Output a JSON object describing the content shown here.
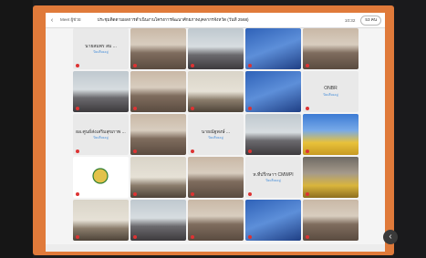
{
  "topbar": {
    "back_icon": "‹",
    "app": "Meet ผู้ช่วย",
    "title": "ประชุมติดตามผลการดำเนินงานโครงการพัฒนาศักยภาพบุคลากรจังหวัด (วันที่ 2568)",
    "time": "10:32",
    "people_label": "53 คน"
  },
  "tiles": [
    {
      "kind": "name",
      "name": "นายสมพร สม ...",
      "sub": "ปิดเสียงอยู่"
    },
    {
      "kind": "video",
      "palette": "meeting-room"
    },
    {
      "kind": "video",
      "palette": "conference"
    },
    {
      "kind": "video",
      "palette": "blue-slide"
    },
    {
      "kind": "video",
      "palette": "meeting-room"
    },
    {
      "kind": "video",
      "palette": "conference"
    },
    {
      "kind": "video",
      "palette": "meeting-room"
    },
    {
      "kind": "video",
      "palette": "office"
    },
    {
      "kind": "video",
      "palette": "blue-slide"
    },
    {
      "kind": "name",
      "name": "ONBR",
      "sub": "ปิดเสียงอยู่"
    },
    {
      "kind": "name",
      "name": "ผอ.ศูนย์ส่งเสริมสุขภาพ ...",
      "sub": "ปิดเสียงอยู่"
    },
    {
      "kind": "video",
      "palette": "meeting-room"
    },
    {
      "kind": "name",
      "name": "นายณัฐพงษ์ ...",
      "sub": "ปิดเสียงอยู่"
    },
    {
      "kind": "video",
      "palette": "conference"
    },
    {
      "kind": "video",
      "palette": "yellow-banner"
    },
    {
      "kind": "logo",
      "name": ""
    },
    {
      "kind": "video",
      "palette": "office"
    },
    {
      "kind": "video",
      "palette": "meeting-room"
    },
    {
      "kind": "name",
      "name": "ห.ที่ปรึกษาฯ CMWPI",
      "sub": "ปิดเสียงอยู่"
    },
    {
      "kind": "video",
      "palette": "yellow-person"
    },
    {
      "kind": "video",
      "palette": "office"
    },
    {
      "kind": "video",
      "palette": "conference"
    },
    {
      "kind": "video",
      "palette": "meeting-room"
    },
    {
      "kind": "video",
      "palette": "blue-slide"
    },
    {
      "kind": "video",
      "palette": "meeting-room"
    }
  ],
  "nav": {
    "next_icon": "‹"
  }
}
